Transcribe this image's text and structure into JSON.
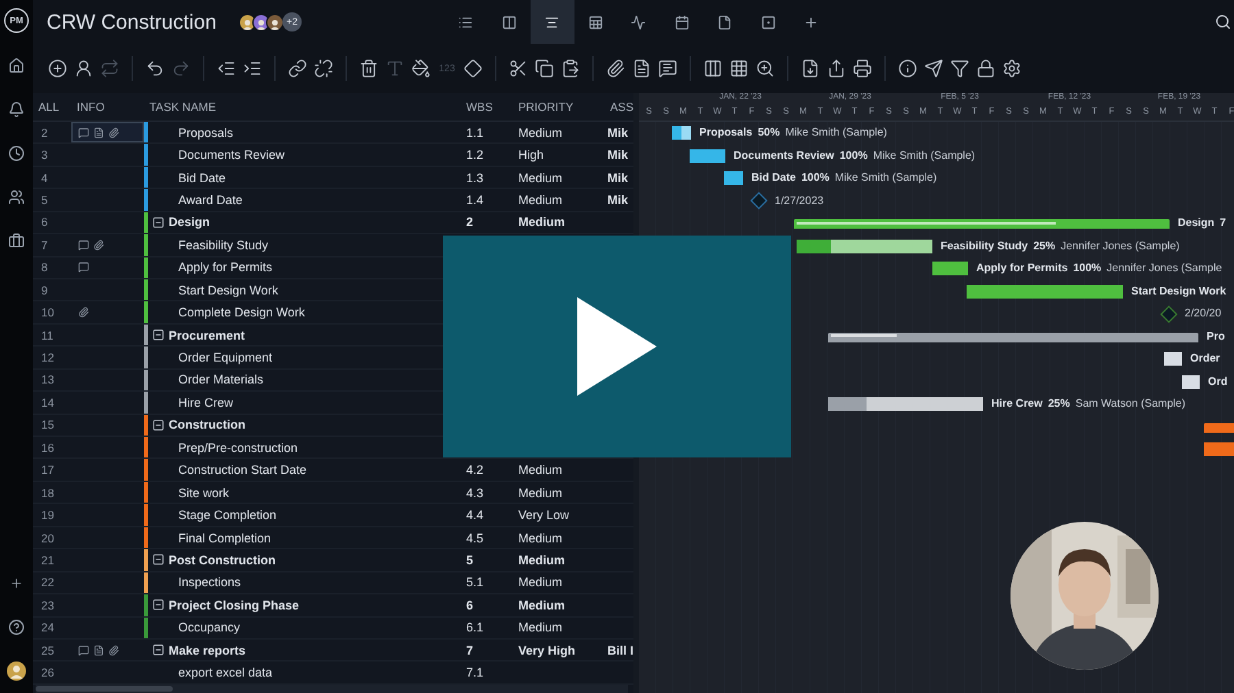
{
  "rail": {
    "logo": "PM"
  },
  "project": {
    "title": "CRW Construction",
    "members": [
      {
        "color": "#c9a24a"
      },
      {
        "color": "#8a6fd6"
      },
      {
        "color": "#7a5a3a"
      }
    ],
    "more": "+2"
  },
  "views": [
    {
      "selected": false
    },
    {
      "selected": false
    },
    {
      "selected": true
    },
    {
      "selected": false
    },
    {
      "selected": false
    },
    {
      "selected": false
    },
    {
      "selected": false
    },
    {
      "selected": false
    }
  ],
  "toolbar_groups": [
    [
      {
        "disabled": false
      },
      {
        "disabled": false
      },
      {
        "disabled": true
      }
    ],
    [
      {
        "disabled": false
      },
      {
        "disabled": true
      }
    ],
    [
      {
        "disabled": false
      },
      {
        "disabled": false
      }
    ],
    [
      {
        "disabled": false
      },
      {
        "disabled": false
      }
    ],
    [
      {
        "disabled": false
      },
      {
        "disabled": true
      },
      {
        "disabled": false
      },
      {
        "label": "123",
        "disabled": true
      },
      {
        "disabled": false
      }
    ],
    [
      {
        "disabled": false
      },
      {
        "disabled": false
      },
      {
        "disabled": false
      }
    ],
    [
      {
        "disabled": false
      },
      {
        "disabled": false
      },
      {
        "disabled": false
      }
    ],
    [
      {
        "disabled": false
      },
      {
        "disabled": false
      },
      {
        "disabled": false
      }
    ],
    [
      {
        "disabled": false
      },
      {
        "disabled": false
      },
      {
        "disabled": false
      }
    ],
    [
      {
        "disabled": false
      },
      {
        "disabled": false
      },
      {
        "disabled": false
      },
      {
        "disabled": false
      },
      {
        "disabled": false
      }
    ]
  ],
  "table": {
    "columns": [
      "ALL",
      "INFO",
      "TASK NAME",
      "WBS",
      "PRIORITY",
      "ASS"
    ],
    "rows": [
      {
        "num": "2",
        "kind": "task",
        "name": "Proposals",
        "wbs": "1.1",
        "priority": "Medium",
        "assignee": "Mik",
        "color": "#2b9be0",
        "selected": true,
        "comments": true,
        "notes": true,
        "attachments": true,
        "bar": {
          "kind": "task",
          "color": "#35b6e8",
          "level": 0.5,
          "name": "Proposals",
          "percent": "50%",
          "assignee": "Mike Smith (Sample)"
        }
      },
      {
        "num": "3",
        "kind": "task",
        "name": "Documents Review",
        "wbs": "1.2",
        "priority": "High",
        "assignee": "Mik",
        "color": "#2b9be0",
        "selected": false,
        "bar": {
          "kind": "task",
          "color": "#35b6e8",
          "level": 1,
          "name": "Documents Review",
          "percent": "100%",
          "assignee": "Mike Smith (Sample)"
        }
      },
      {
        "num": "4",
        "kind": "task",
        "name": "Bid Date",
        "wbs": "1.3",
        "priority": "Medium",
        "assignee": "Mik",
        "color": "#2b9be0",
        "selected": false,
        "bar": {
          "kind": "task",
          "color": "#35b6e8",
          "level": 1,
          "name": "Bid Date",
          "percent": "100%",
          "assignee": "Mike Smith (Sample)"
        }
      },
      {
        "num": "5",
        "kind": "task",
        "name": "Award Date",
        "wbs": "1.4",
        "priority": "Medium",
        "assignee": "Mik",
        "color": "#2b9be0",
        "selected": false,
        "bar": {
          "kind": "milestone",
          "color": "#2b6ea0",
          "date": "1/27/2023"
        }
      },
      {
        "num": "6",
        "kind": "group",
        "name": "Design",
        "wbs": "2",
        "priority": "Medium",
        "color": "#4fbf3f",
        "selected": false,
        "bar": {
          "kind": "summary",
          "color": "#4fbf3f",
          "level": 0.7,
          "name": "Design",
          "percent": "7"
        }
      },
      {
        "num": "7",
        "kind": "task",
        "name": "Feasibility Study",
        "color": "#4fbf3f",
        "selected": false,
        "comments": true,
        "attachments": true,
        "bar": {
          "kind": "task",
          "color": "#3fae38",
          "level": 0.25,
          "name": "Feasibility Study",
          "percent": "25%",
          "assignee": "Jennifer Jones (Sample)"
        }
      },
      {
        "num": "8",
        "kind": "task",
        "name": "Apply for Permits",
        "color": "#4fbf3f",
        "selected": false,
        "comments": true,
        "bar": {
          "kind": "task",
          "color": "#4fbf3f",
          "level": 1,
          "name": "Apply for Permits",
          "percent": "100%",
          "assignee": "Jennifer Jones (Sample"
        }
      },
      {
        "num": "9",
        "kind": "task",
        "name": "Start Design Work",
        "color": "#4fbf3f",
        "selected": false,
        "bar": {
          "kind": "task",
          "color": "#4fbf3f",
          "name": "Start Design Work"
        }
      },
      {
        "num": "10",
        "kind": "task",
        "name": "Complete Design Work",
        "color": "#4fbf3f",
        "selected": false,
        "attachments": true,
        "bar": {
          "kind": "milestone",
          "color": "#3a7a30",
          "date": "2/20/20"
        }
      },
      {
        "num": "11",
        "kind": "group",
        "name": "Procurement",
        "color": "#9aa0a8",
        "selected": false,
        "bar": {
          "kind": "summary",
          "color": "#9aa0a8",
          "level": 0.18,
          "name": "Pro"
        }
      },
      {
        "num": "12",
        "kind": "task",
        "name": "Order Equipment",
        "color": "#9aa0a8",
        "selected": false,
        "bar": {
          "kind": "task",
          "color": "#d8dde4",
          "name": "Order"
        }
      },
      {
        "num": "13",
        "kind": "task",
        "name": "Order Materials",
        "color": "#9aa0a8",
        "selected": false,
        "bar": {
          "kind": "task",
          "color": "#d8dde4",
          "name": "Ord"
        }
      },
      {
        "num": "14",
        "kind": "task",
        "name": "Hire Crew",
        "color": "#9aa0a8",
        "selected": false,
        "bar": {
          "kind": "task",
          "color": "#9aa0a8",
          "level": 0.25,
          "name": "Hire Crew",
          "percent": "25%",
          "assignee": "Sam Watson (Sample)"
        }
      },
      {
        "num": "15",
        "kind": "group",
        "name": "Construction",
        "color": "#f06a1a",
        "selected": false,
        "bar": {
          "kind": "summary",
          "color": "#f06a1a"
        }
      },
      {
        "num": "16",
        "kind": "task",
        "name": "Prep/Pre-construction",
        "color": "#f06a1a",
        "selected": false,
        "bar": {
          "kind": "task",
          "color": "#f06a1a"
        }
      },
      {
        "num": "17",
        "kind": "task",
        "name": "Construction Start Date",
        "wbs": "4.2",
        "priority": "Medium",
        "color": "#f06a1a",
        "selected": false
      },
      {
        "num": "18",
        "kind": "task",
        "name": "Site work",
        "wbs": "4.3",
        "priority": "Medium",
        "color": "#f06a1a",
        "selected": false
      },
      {
        "num": "19",
        "kind": "task",
        "name": "Stage Completion",
        "wbs": "4.4",
        "priority": "Very Low",
        "color": "#f06a1a",
        "selected": false
      },
      {
        "num": "20",
        "kind": "task",
        "name": "Final Completion",
        "wbs": "4.5",
        "priority": "Medium",
        "color": "#f06a1a",
        "selected": false
      },
      {
        "num": "21",
        "kind": "group",
        "name": "Post Construction",
        "wbs": "5",
        "priority": "Medium",
        "color": "#f0a050",
        "selected": false
      },
      {
        "num": "22",
        "kind": "task",
        "name": "Inspections",
        "wbs": "5.1",
        "priority": "Medium",
        "color": "#f0a050",
        "selected": false
      },
      {
        "num": "23",
        "kind": "group",
        "name": "Project Closing Phase",
        "wbs": "6",
        "priority": "Medium",
        "color": "#3a9a3a",
        "selected": false
      },
      {
        "num": "24",
        "kind": "task",
        "name": "Occupancy",
        "wbs": "6.1",
        "priority": "Medium",
        "color": "#3a9a3a",
        "selected": false
      },
      {
        "num": "25",
        "kind": "group",
        "name": "Make reports",
        "wbs": "7",
        "priority": "Very High",
        "assignee": "Bill I",
        "selected": false,
        "comments": true,
        "notes": true,
        "attachments": true
      },
      {
        "num": "26",
        "kind": "task",
        "name": "export excel data",
        "wbs": "7.1",
        "selected": false
      }
    ]
  },
  "gantt": {
    "weeks": [
      "JAN, 22 '23",
      "JAN, 29 '23",
      "FEB, 5 '23",
      "FEB, 12 '23",
      "FEB, 19 '23"
    ],
    "days": [
      "S",
      "S",
      "M",
      "T",
      "W",
      "T",
      "F",
      "S",
      "S",
      "M",
      "T",
      "W",
      "T",
      "F",
      "S",
      "S",
      "M",
      "T",
      "W",
      "T",
      "F",
      "S",
      "S",
      "M",
      "T",
      "W",
      "T",
      "F",
      "S",
      "S",
      "M",
      "T",
      "W",
      "T",
      "F"
    ]
  }
}
